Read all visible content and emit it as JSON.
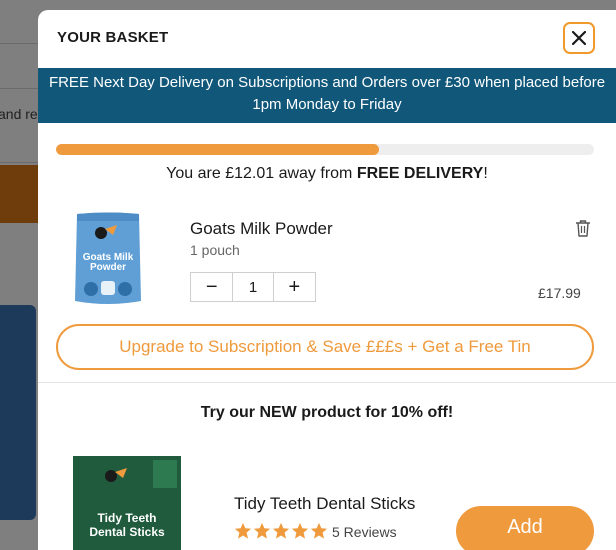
{
  "background": {
    "partial_text": "and re"
  },
  "basket": {
    "title": "YOUR BASKET",
    "close_icon": "close-icon",
    "banner": "FREE Next Day Delivery on Subscriptions and Orders over £30 when placed before 1pm Monday to Friday",
    "progress_fraction": 0.6,
    "away_prefix": "You are £12.01 away from ",
    "away_bold": "FREE DELIVERY",
    "away_suffix": "!",
    "item": {
      "name": "Goats Milk Powder",
      "variant": "1 pouch",
      "quantity": "1",
      "price": "£17.99",
      "minus": "−",
      "plus": "+",
      "image_text": "Goats Milk Powder",
      "delete_icon": "trash-icon"
    },
    "upgrade_label": "Upgrade to Subscription & Save £££s + Get a Free Tin",
    "promo_heading": "Try our NEW product for 10% off!",
    "recommendation": {
      "name": "Tidy Teeth Dental Sticks",
      "image_text": "Tidy Teeth Dental Sticks",
      "rating": 5,
      "reviews": "5 Reviews",
      "add_label": "Add"
    }
  },
  "colors": {
    "accent": "#ef9a3c",
    "banner": "#10577a",
    "overlay": "#7f7f7f"
  }
}
